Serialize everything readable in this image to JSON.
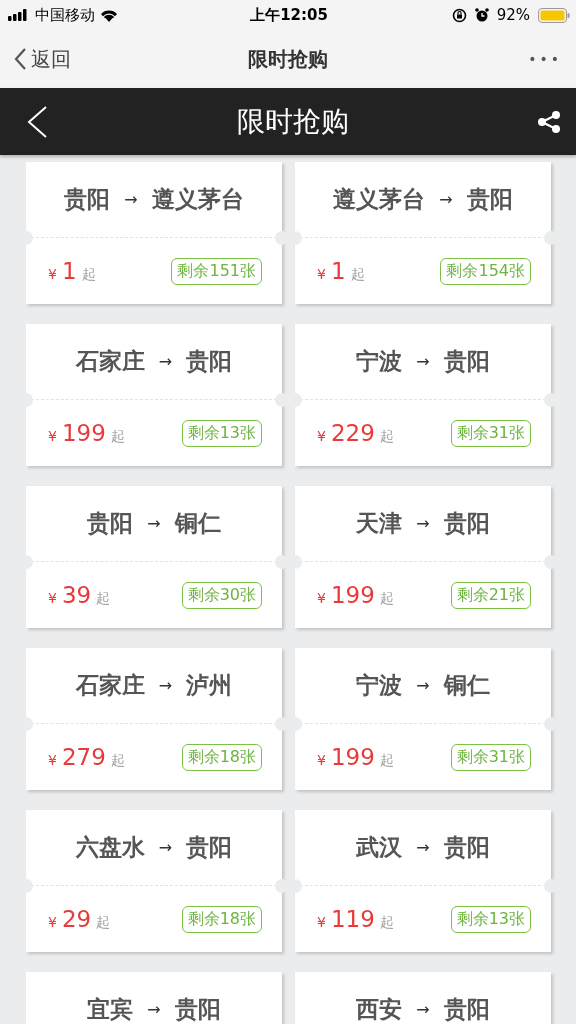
{
  "status_bar": {
    "carrier": "中国移动",
    "time": "上午12:05",
    "battery": "92%"
  },
  "nav_bar": {
    "back": "返回",
    "title": "限时抢购",
    "more": "•••"
  },
  "header": {
    "title": "限时抢购"
  },
  "cards": [
    {
      "from": "贵阳",
      "arrow": "→",
      "to": "遵义茅台",
      "currency": "¥",
      "price": "1",
      "suffix": "起",
      "remaining": "剩余151张"
    },
    {
      "from": "遵义茅台",
      "arrow": "→",
      "to": "贵阳",
      "currency": "¥",
      "price": "1",
      "suffix": "起",
      "remaining": "剩余154张"
    },
    {
      "from": "石家庄",
      "arrow": "→",
      "to": "贵阳",
      "currency": "¥",
      "price": "199",
      "suffix": "起",
      "remaining": "剩余13张"
    },
    {
      "from": "宁波",
      "arrow": "→",
      "to": "贵阳",
      "currency": "¥",
      "price": "229",
      "suffix": "起",
      "remaining": "剩余31张"
    },
    {
      "from": "贵阳",
      "arrow": "→",
      "to": "铜仁",
      "currency": "¥",
      "price": "39",
      "suffix": "起",
      "remaining": "剩余30张"
    },
    {
      "from": "天津",
      "arrow": "→",
      "to": "贵阳",
      "currency": "¥",
      "price": "199",
      "suffix": "起",
      "remaining": "剩余21张"
    },
    {
      "from": "石家庄",
      "arrow": "→",
      "to": "泸州",
      "currency": "¥",
      "price": "279",
      "suffix": "起",
      "remaining": "剩余18张"
    },
    {
      "from": "宁波",
      "arrow": "→",
      "to": "铜仁",
      "currency": "¥",
      "price": "199",
      "suffix": "起",
      "remaining": "剩余31张"
    },
    {
      "from": "六盘水",
      "arrow": "→",
      "to": "贵阳",
      "currency": "¥",
      "price": "29",
      "suffix": "起",
      "remaining": "剩余18张"
    },
    {
      "from": "武汉",
      "arrow": "→",
      "to": "贵阳",
      "currency": "¥",
      "price": "119",
      "suffix": "起",
      "remaining": "剩余13张"
    },
    {
      "from": "宜宾",
      "arrow": "→",
      "to": "贵阳"
    },
    {
      "from": "西安",
      "arrow": "→",
      "to": "贵阳"
    }
  ]
}
